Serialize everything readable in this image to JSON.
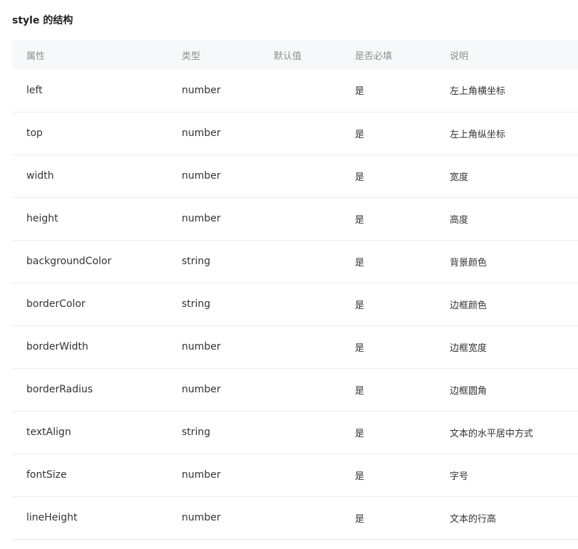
{
  "section": {
    "title": "style 的结构"
  },
  "table": {
    "headers": [
      "属性",
      "类型",
      "默认值",
      "是否必填",
      "说明"
    ],
    "rows": [
      {
        "name": "left",
        "type": "number",
        "default": "",
        "required": "是",
        "description": "左上角横坐标"
      },
      {
        "name": "top",
        "type": "number",
        "default": "",
        "required": "是",
        "description": "左上角纵坐标"
      },
      {
        "name": "width",
        "type": "number",
        "default": "",
        "required": "是",
        "description": "宽度"
      },
      {
        "name": "height",
        "type": "number",
        "default": "",
        "required": "是",
        "description": "高度"
      },
      {
        "name": "backgroundColor",
        "type": "string",
        "default": "",
        "required": "是",
        "description": "背景颜色"
      },
      {
        "name": "borderColor",
        "type": "string",
        "default": "",
        "required": "是",
        "description": "边框颜色"
      },
      {
        "name": "borderWidth",
        "type": "number",
        "default": "",
        "required": "是",
        "description": "边框宽度"
      },
      {
        "name": "borderRadius",
        "type": "number",
        "default": "",
        "required": "是",
        "description": "边框圆角"
      },
      {
        "name": "textAlign",
        "type": "string",
        "default": "",
        "required": "是",
        "description": "文本的水平居中方式"
      },
      {
        "name": "fontSize",
        "type": "number",
        "default": "",
        "required": "是",
        "description": "字号"
      },
      {
        "name": "lineHeight",
        "type": "number",
        "default": "",
        "required": "是",
        "description": "文本的行高"
      }
    ]
  }
}
